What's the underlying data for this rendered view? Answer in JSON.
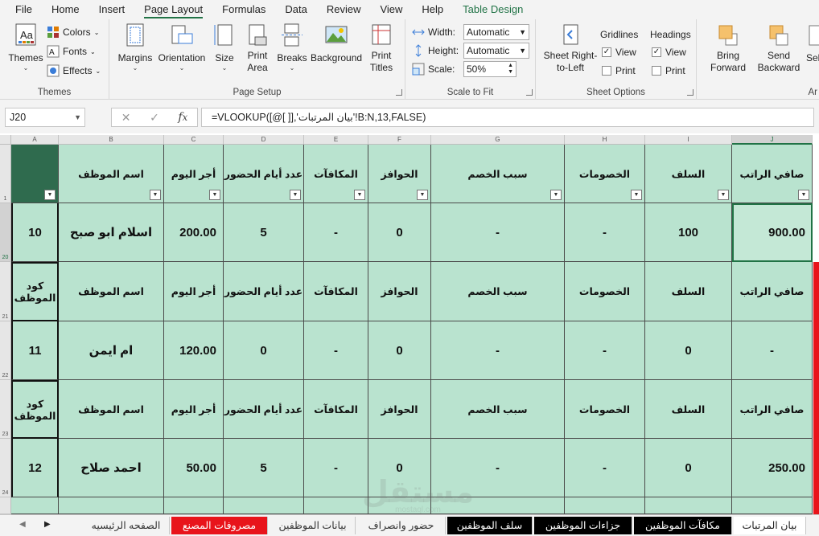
{
  "menu": {
    "tabs": [
      "File",
      "Home",
      "Insert",
      "Page Layout",
      "Formulas",
      "Data",
      "Review",
      "View",
      "Help",
      "Table Design"
    ],
    "active": "Page Layout"
  },
  "ribbon": {
    "themes": {
      "label": "Themes",
      "themes_btn": "Themes",
      "colors": "Colors",
      "fonts": "Fonts",
      "effects": "Effects"
    },
    "page_setup": {
      "label": "Page Setup",
      "margins": "Margins",
      "orientation": "Orientation",
      "size": "Size",
      "print_area": "Print Area",
      "breaks": "Breaks",
      "background": "Background",
      "print_titles": "Print Titles"
    },
    "scale": {
      "label": "Scale to Fit",
      "width_label": "Width:",
      "width_value": "Automatic",
      "height_label": "Height:",
      "height_value": "Automatic",
      "scale_label": "Scale:",
      "scale_value": "50%"
    },
    "sheet_options": {
      "label": "Sheet Options",
      "sheet_rtl": "Sheet Right-to-Left",
      "gridlines": "Gridlines",
      "headings": "Headings",
      "view": "View",
      "print": "Print"
    },
    "arrange": {
      "label": "Ar",
      "bring_forward": "Bring Forward",
      "send_backward": "Send Backward",
      "selection": "Sel"
    }
  },
  "formula_bar": {
    "name_box": "J20",
    "formula": "=VLOOKUP([@[ ]],'بيان المرتبات'!B:N,13,FALSE)"
  },
  "columns": [
    "A",
    "B",
    "C",
    "D",
    "E",
    "F",
    "G",
    "H",
    "I",
    "J"
  ],
  "rows": [
    "1",
    "20",
    "21",
    "22",
    "23",
    "24"
  ],
  "headers": {
    "code": "كود الموظف",
    "name": "اسم الموظف",
    "daily": "أجر اليوم",
    "days": "عدد أيام الحضور",
    "bonus": "المكافآت",
    "incentives": "الحوافز",
    "reason": "سبب الخصم",
    "deductions": "الخصومات",
    "advances": "السلف",
    "net": "صافي الراتب"
  },
  "records": [
    {
      "code": "10",
      "name": "اسلام ابو صبح",
      "daily": "200.00",
      "days": "5",
      "bonus": "-",
      "incentives": "0",
      "reason": "-",
      "deductions": "-",
      "advances": "100",
      "net": "900.00"
    },
    {
      "code": "11",
      "name": "ام ايمن",
      "daily": "120.00",
      "days": "0",
      "bonus": "-",
      "incentives": "0",
      "reason": "-",
      "deductions": "-",
      "advances": "0",
      "net": "-"
    },
    {
      "code": "12",
      "name": "احمد صلاح",
      "daily": "50.00",
      "days": "5",
      "bonus": "-",
      "incentives": "0",
      "reason": "-",
      "deductions": "-",
      "advances": "0",
      "net": "250.00"
    }
  ],
  "sheet_tabs": [
    "بيان المرتبات",
    "مكافآت الموظفين",
    "جزاءات الموظفين",
    "سلف الموظفين",
    "حضور وانصراف",
    "بيانات الموظفين",
    "مصروفات المصنع",
    "الصفحه الرئيسيه"
  ],
  "watermark": {
    "text": "مستقل",
    "sub": "mostaql.com"
  },
  "colors": {
    "cell_fill": "#b9e3cf",
    "accent": "#217346",
    "dark_tab": "#000000",
    "red_tab": "#e8141b"
  }
}
